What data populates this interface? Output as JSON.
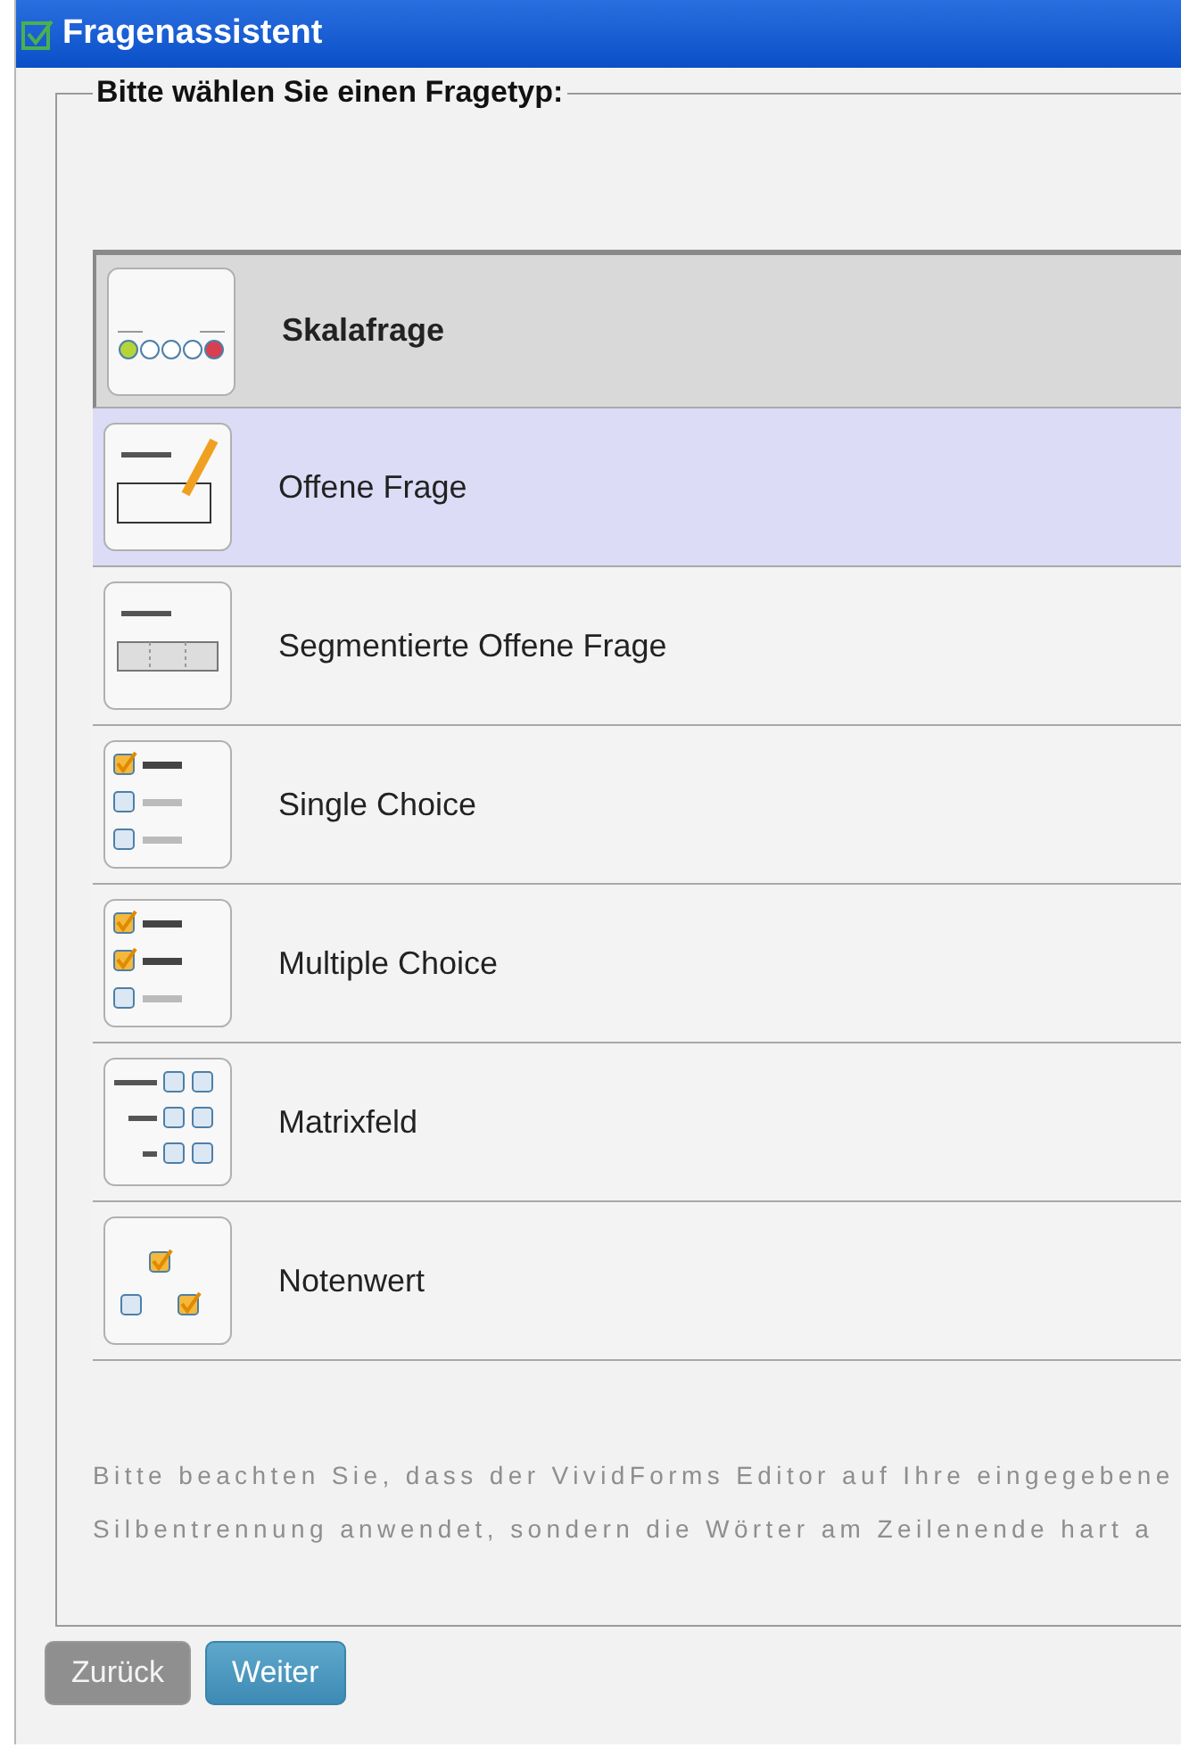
{
  "window": {
    "title": "Fragenassistent"
  },
  "group": {
    "legend": "Bitte wählen Sie einen Fragetyp:"
  },
  "question_types": [
    {
      "kind": "scale",
      "label": "Skalafrage",
      "selected": true,
      "hovered": false
    },
    {
      "kind": "open",
      "label": "Offene Frage",
      "selected": false,
      "hovered": true
    },
    {
      "kind": "segmented",
      "label": "Segmentierte Offene Frage",
      "selected": false,
      "hovered": false
    },
    {
      "kind": "single",
      "label": "Single Choice",
      "selected": false,
      "hovered": false
    },
    {
      "kind": "multiple",
      "label": "Multiple Choice",
      "selected": false,
      "hovered": false
    },
    {
      "kind": "matrix",
      "label": "Matrixfeld",
      "selected": false,
      "hovered": false
    },
    {
      "kind": "grade",
      "label": "Notenwert",
      "selected": false,
      "hovered": false
    }
  ],
  "note": [
    "Bitte beachten Sie, dass der VividForms Editor auf Ihre eingegebene",
    "Silbentrennung anwendet, sondern die Wörter am Zeilenende hart a"
  ],
  "buttons": [
    {
      "label": "Zurück",
      "disabled": true
    },
    {
      "label": "Weiter",
      "disabled": false
    }
  ]
}
